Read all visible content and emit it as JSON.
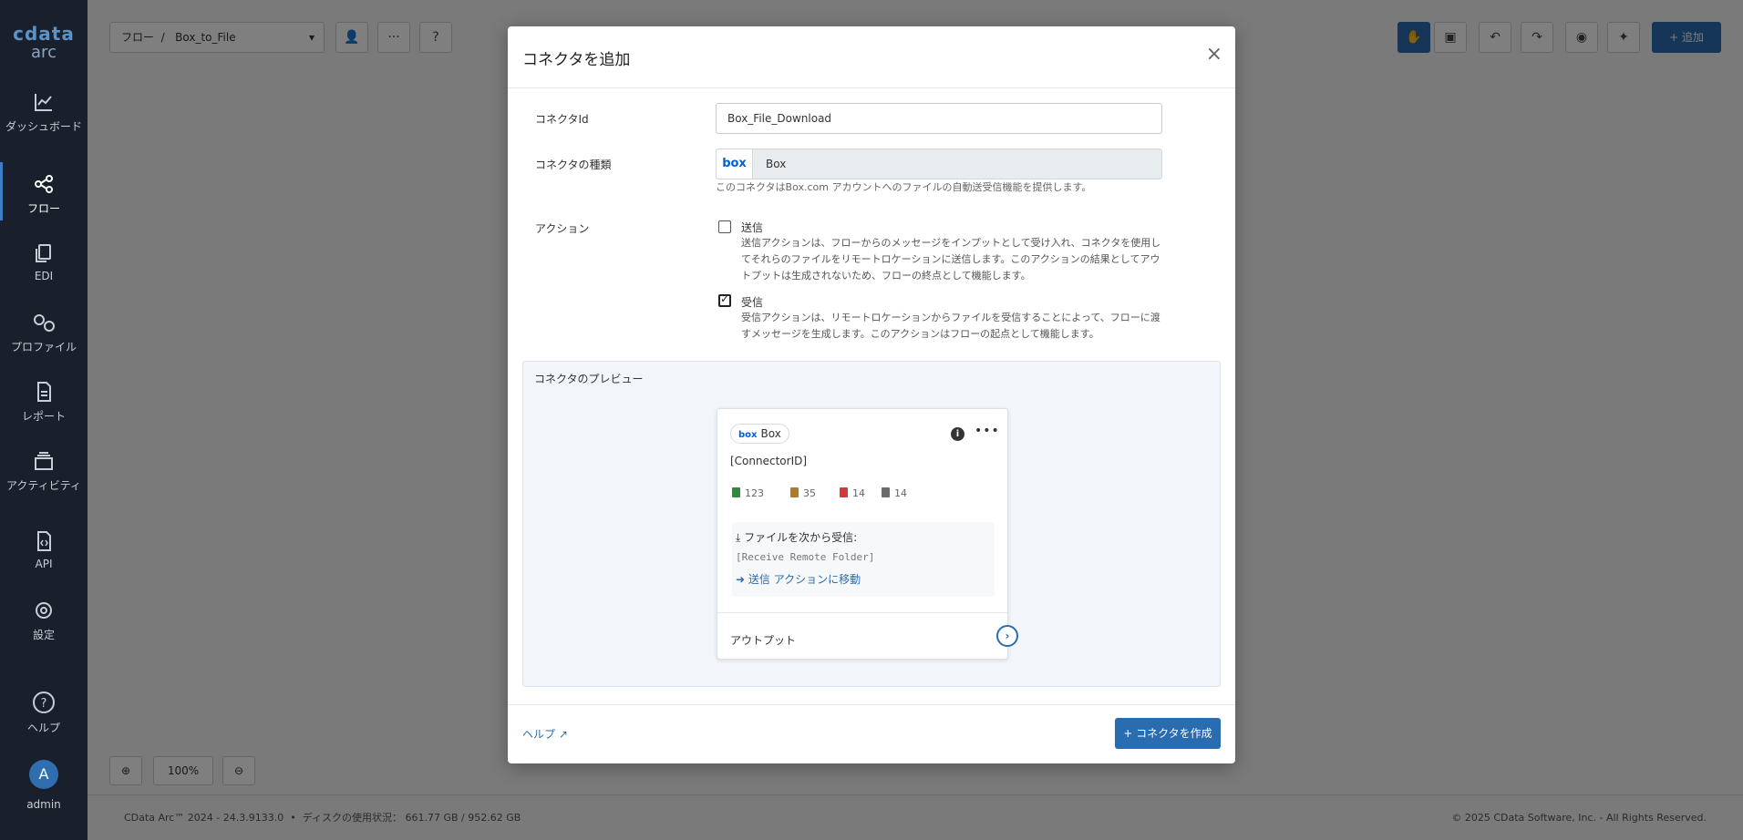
{
  "logo": {
    "line1": "cdata",
    "line2": "arc"
  },
  "sidebar": {
    "items": [
      {
        "label": "ダッシュボード",
        "icon": "chart-line-icon"
      },
      {
        "label": "フロー",
        "icon": "flow-icon",
        "active": true
      },
      {
        "label": "EDI",
        "icon": "documents-icon"
      },
      {
        "label": "プロファイル",
        "icon": "gears-icon"
      },
      {
        "label": "レポート",
        "icon": "report-icon"
      },
      {
        "label": "アクティビティ",
        "icon": "layers-icon"
      },
      {
        "label": "API",
        "icon": "code-file-icon"
      },
      {
        "label": "設定",
        "icon": "gear-icon"
      },
      {
        "label": "ヘルプ",
        "icon": "help-circle-icon"
      }
    ],
    "user": {
      "initial": "A",
      "name": "admin"
    }
  },
  "toolbar": {
    "breadcrumb_root": "フロー",
    "separator": "/",
    "flow_name": "Box_to_File",
    "add_label": "+ 追加"
  },
  "zoom": {
    "level": "100%"
  },
  "footer": {
    "version": "CData Arc™ 2024 - 24.3.9133.0",
    "disk_label": "ディスクの使用状況：",
    "disk_value": "661.77 GB / 952.62 GB",
    "copyright": "© 2025 CData Software, Inc. - All Rights Reserved."
  },
  "modal": {
    "title": "コネクタを追加",
    "close": "×",
    "connector_id_label": "コネクタId",
    "connector_id_value": "Box_File_Download",
    "connector_type_label": "コネクタの種類",
    "connector_type_logo": "box",
    "connector_type_value": "Box",
    "connector_type_help": "このコネクタはBox.com アカウントへのファイルの自動送受信機能を提供します。",
    "action_label": "アクション",
    "actions": [
      {
        "label": "送信",
        "checked": false,
        "desc": "送信アクションは、フローからのメッセージをインプットとして受け入れ、コネクタを使用してそれらのファイルをリモートロケーションに送信します。このアクションの結果としてアウトプットは生成されないため、フローの終点として機能します。"
      },
      {
        "label": "受信",
        "checked": true,
        "desc": "受信アクションは、リモートロケーションからファイルを受信することによって、フローに渡すメッセージを生成します。このアクションはフローの起点として機能します。"
      }
    ],
    "preview": {
      "title": "コネクタのプレビュー",
      "chip_logo": "box",
      "chip_label": "Box",
      "info_icon": "i",
      "more_icon": "•••",
      "connector_id": "[ConnectorID]",
      "stats": [
        {
          "value": "123",
          "color": "#2e8b3d",
          "icon": "file-success-icon"
        },
        {
          "value": "35",
          "color": "#b07a2a",
          "icon": "file-pending-icon"
        },
        {
          "value": "14",
          "color": "#d23a3a",
          "icon": "file-error-icon"
        },
        {
          "value": "14",
          "color": "#6b6b6b",
          "icon": "hourglass-icon"
        }
      ],
      "action_title": "ファイルを次から受信:",
      "action_folder": "[Receive Remote Folder]",
      "action_link": "送信 アクションに移動",
      "output_label": "アウトプット"
    },
    "help_link": "ヘルプ",
    "create_button": "+ コネクタを作成"
  }
}
